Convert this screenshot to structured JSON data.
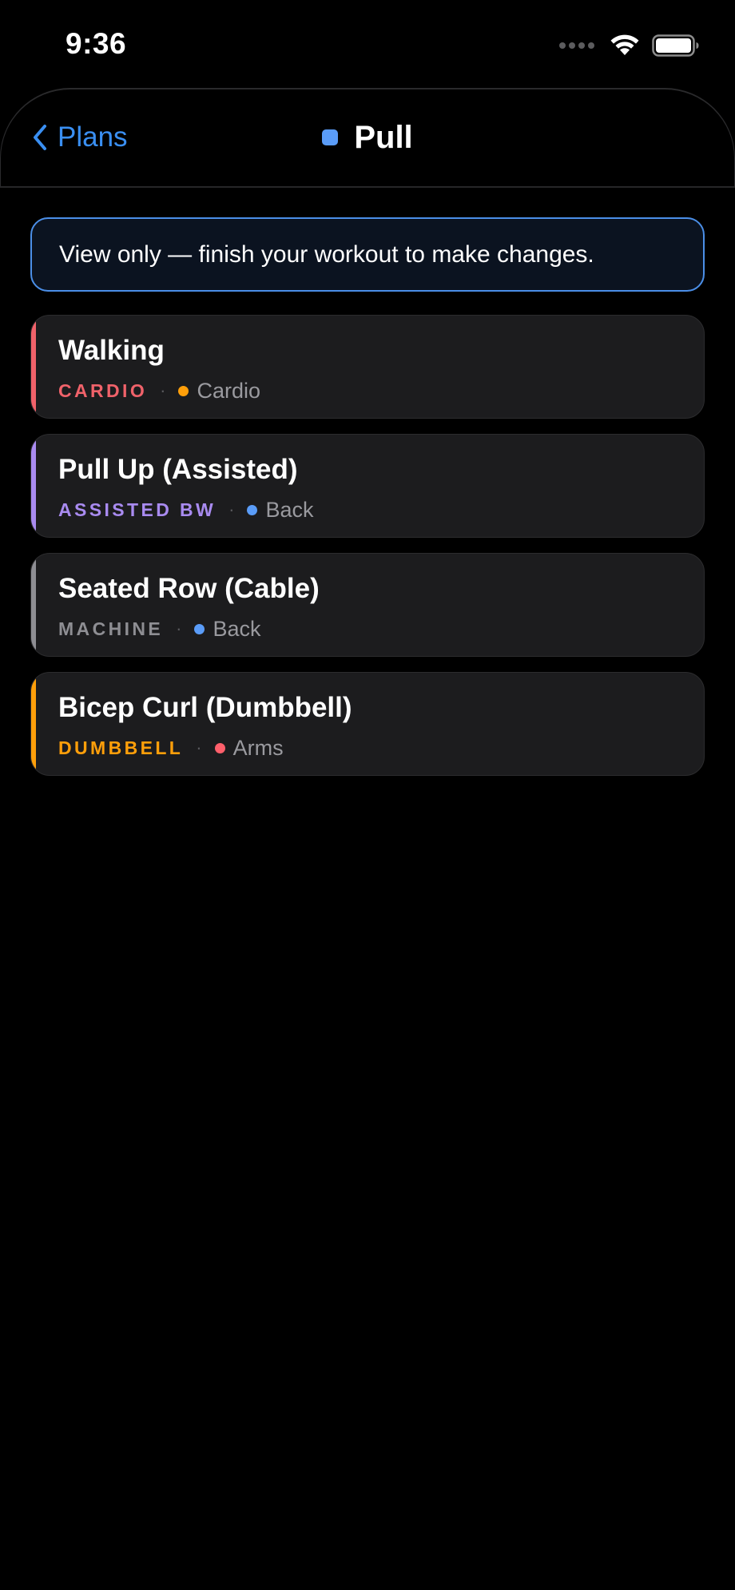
{
  "status_bar": {
    "time": "9:36",
    "icons": [
      "cellular-signal-icon",
      "wifi-icon",
      "battery-icon"
    ]
  },
  "nav": {
    "back_label": "Plans",
    "title": "Pull",
    "plan_color": "#5a9cf8",
    "accent_color": "#3a8ff2"
  },
  "banner": {
    "text": "View only — finish your workout to make changes.",
    "border_color": "#4b8fe8"
  },
  "exercises": [
    {
      "name": "Walking",
      "equipment": "CARDIO",
      "equipment_color": "#f0626a",
      "separator": "·",
      "muscle": "Cardio",
      "muscle_color": "#ff9f0a"
    },
    {
      "name": "Pull Up (Assisted)",
      "equipment": "ASSISTED BW",
      "equipment_color": "#a98bf0",
      "separator": "·",
      "muscle": "Back",
      "muscle_color": "#5a9cf8"
    },
    {
      "name": "Seated Row (Cable)",
      "equipment": "MACHINE",
      "equipment_color": "#8e8e93",
      "separator": "·",
      "muscle": "Back",
      "muscle_color": "#5a9cf8"
    },
    {
      "name": "Bicep Curl (Dumbbell)",
      "equipment": "DUMBBELL",
      "equipment_color": "#ff9f0a",
      "separator": "·",
      "muscle": "Arms",
      "muscle_color": "#ff5f6b"
    }
  ]
}
